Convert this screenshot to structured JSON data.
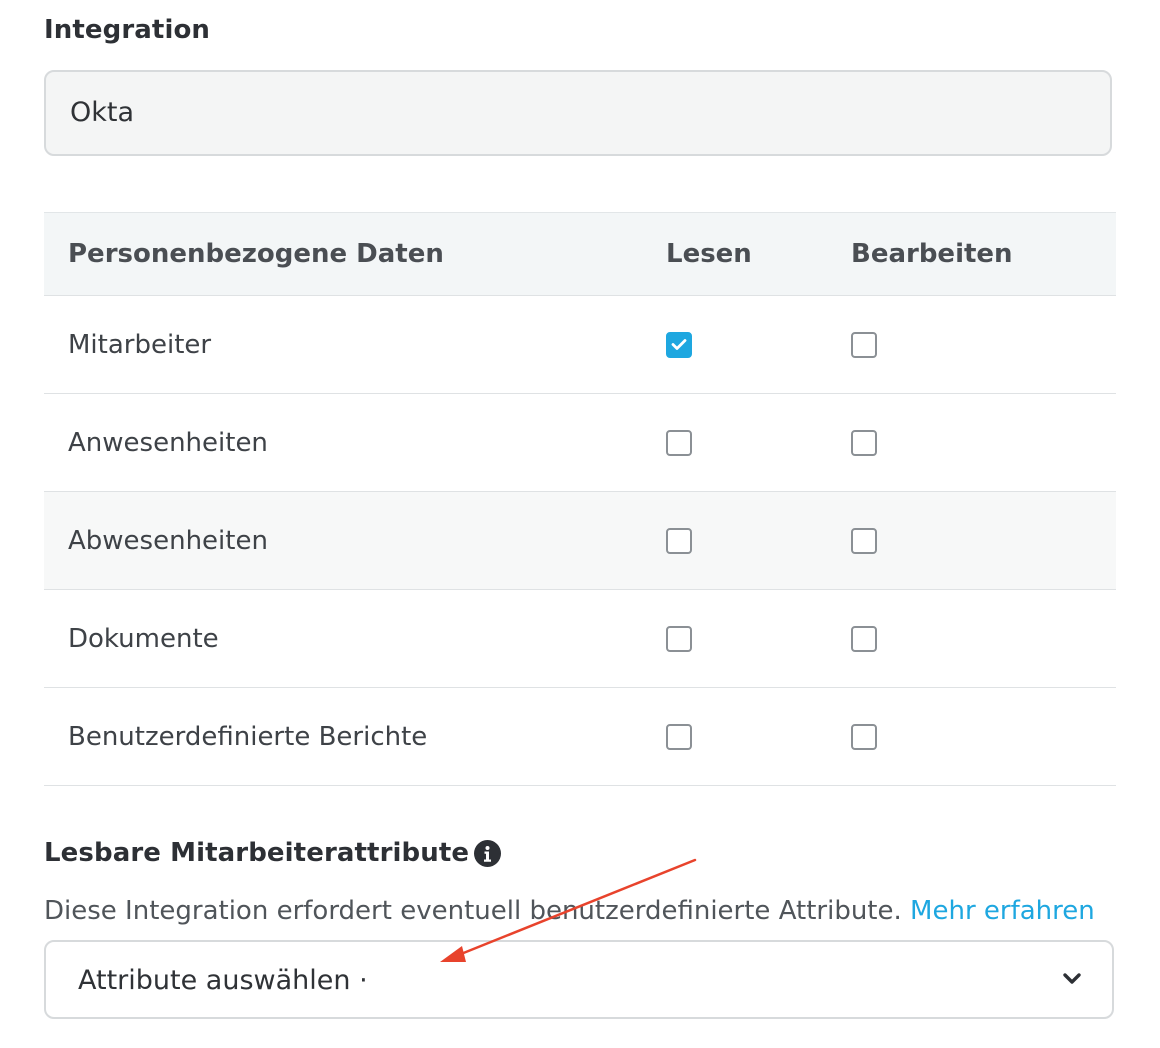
{
  "integration": {
    "label": "Integration",
    "value": "Okta"
  },
  "permissions": {
    "headers": {
      "name": "Personenbezogene Daten",
      "read": "Lesen",
      "edit": "Bearbeiten"
    },
    "rows": [
      {
        "name": "Mitarbeiter",
        "read": true,
        "edit": false
      },
      {
        "name": "Anwesenheiten",
        "read": false,
        "edit": false
      },
      {
        "name": "Abwesenheiten",
        "read": false,
        "edit": false
      },
      {
        "name": "Dokumente",
        "read": false,
        "edit": false
      },
      {
        "name": "Benutzerdefinierte Berichte",
        "read": false,
        "edit": false
      }
    ]
  },
  "attributes": {
    "label": "Lesbare Mitarbeiterattribute",
    "help_text": "Diese Integration erfordert eventuell benutzerdefinierte Attribute.",
    "help_link": "Mehr erfahren",
    "select_value": "Attribute auswählen ·",
    "info_icon": "info-icon",
    "chevron_icon": "chevron-down-icon"
  },
  "colors": {
    "accent": "#1ea7e0",
    "annotation": "#e8432c"
  }
}
